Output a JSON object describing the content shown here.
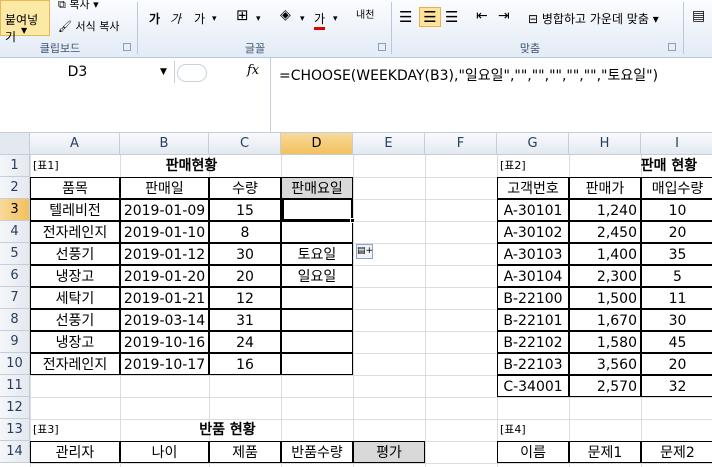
{
  "ribbon": {
    "paste_label": "붙여넣기",
    "copy_label": "복사 ▾",
    "format_painter_label": "서식 복사",
    "clipboard_group": "클립보드",
    "font_group": "글꼴",
    "align_group": "맞춤",
    "merge_center_label": "병합하고 가운데 맞춤 ▾",
    "font_grow": "가",
    "font_shrink": "가",
    "font_sample": "가",
    "font_color_glyph": "가",
    "ko_script": "내천"
  },
  "formula_bar": {
    "name_box": "D3",
    "fx": "fx",
    "formula": "=CHOOSE(WEEKDAY(B3),\"일요일\",\"\",\"\",\"\",\"\",\"\",\"토요일\")"
  },
  "columns": [
    "A",
    "B",
    "C",
    "D",
    "E",
    "F",
    "G",
    "H",
    "I"
  ],
  "rows": [
    "1",
    "2",
    "3",
    "4",
    "5",
    "6",
    "7",
    "8",
    "9",
    "10",
    "11",
    "12",
    "13",
    "14"
  ],
  "sheet": {
    "t1_label": "[표1]",
    "t1_title": "판매현황",
    "t1_headers": [
      "품목",
      "판매일",
      "수량",
      "판매요일"
    ],
    "t1_rows": [
      [
        "텔레비전",
        "2019-01-09",
        "15",
        ""
      ],
      [
        "전자레인지",
        "2019-01-10",
        "8",
        ""
      ],
      [
        "선풍기",
        "2019-01-12",
        "30",
        "토요일"
      ],
      [
        "냉장고",
        "2019-01-20",
        "20",
        "일요일"
      ],
      [
        "세탁기",
        "2019-01-21",
        "12",
        ""
      ],
      [
        "선풍기",
        "2019-03-14",
        "31",
        ""
      ],
      [
        "냉장고",
        "2019-10-16",
        "24",
        ""
      ],
      [
        "전자레인지",
        "2019-10-17",
        "16",
        ""
      ]
    ],
    "t2_label": "[표2]",
    "t2_title": "판매 현황",
    "t2_headers": [
      "고객번호",
      "판매가",
      "매입수량"
    ],
    "t2_rows": [
      [
        "A-30101",
        "1,240",
        "10"
      ],
      [
        "A-30102",
        "2,450",
        "20"
      ],
      [
        "A-30103",
        "1,400",
        "35"
      ],
      [
        "A-30104",
        "2,300",
        "5"
      ],
      [
        "B-22100",
        "1,500",
        "11"
      ],
      [
        "B-22101",
        "1,670",
        "30"
      ],
      [
        "B-22102",
        "1,580",
        "45"
      ],
      [
        "B-22103",
        "3,560",
        "20"
      ],
      [
        "C-34001",
        "2,570",
        "32"
      ]
    ],
    "t3_label": "[표3]",
    "t3_title": "반품 현황",
    "t3_headers": [
      "관리자",
      "나이",
      "제품",
      "반품수량",
      "평가"
    ],
    "t4_label": "[표4]",
    "t4_headers": [
      "이름",
      "문제1",
      "문제2"
    ]
  },
  "autofill_icon": "autofill-options-icon"
}
